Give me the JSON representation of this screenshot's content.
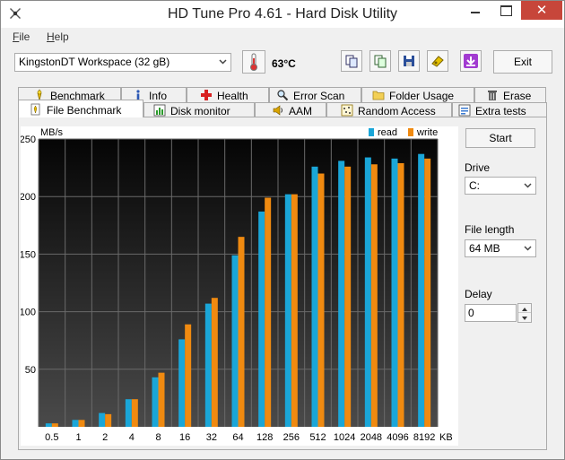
{
  "window": {
    "title": "HD Tune Pro 4.61 - Hard Disk Utility",
    "close_symbol": "✕"
  },
  "menu": {
    "items": [
      {
        "label": "File",
        "underline": "F",
        "rest": "ile"
      },
      {
        "label": "Help",
        "underline": "H",
        "rest": "elp"
      }
    ]
  },
  "toolbar": {
    "drive": "KingstonDT Workspace (32 gB)",
    "temperature": "63°C",
    "exit_label": "Exit",
    "buttons": [
      "copy-info-icon",
      "copy-screenshot-icon",
      "save-icon",
      "options-icon",
      "download-icon"
    ]
  },
  "tabs": {
    "top": [
      {
        "label": "Benchmark",
        "icon": "benchmark-icon"
      },
      {
        "label": "Info",
        "icon": "info-icon"
      },
      {
        "label": "Health",
        "icon": "health-icon"
      },
      {
        "label": "Error Scan",
        "icon": "error-scan-icon"
      },
      {
        "label": "Folder Usage",
        "icon": "folder-icon"
      },
      {
        "label": "Erase",
        "icon": "trash-icon"
      }
    ],
    "bottom": [
      {
        "label": "File Benchmark",
        "icon": "file-benchmark-icon",
        "active": true
      },
      {
        "label": "Disk monitor",
        "icon": "disk-monitor-icon"
      },
      {
        "label": "AAM",
        "icon": "speaker-icon"
      },
      {
        "label": "Random Access",
        "icon": "random-access-icon"
      },
      {
        "label": "Extra tests",
        "icon": "extra-tests-icon"
      }
    ]
  },
  "controls": {
    "start_label": "Start",
    "drive_label": "Drive",
    "drive_value": "C:",
    "file_length_label": "File length",
    "file_length_value": "64 MB",
    "delay_label": "Delay",
    "delay_value": "0"
  },
  "colors": {
    "read": "#1aa6d8",
    "write": "#f08a10",
    "chart_bg_top": "#050505",
    "chart_bg_bottom": "#4a4a4a"
  },
  "chart_data": {
    "type": "bar",
    "ylabel": "MB/s",
    "xunit": "KB",
    "ylim": [
      0,
      250
    ],
    "yticks": [
      50,
      100,
      150,
      200,
      250
    ],
    "categories": [
      "0.5",
      "1",
      "2",
      "4",
      "8",
      "16",
      "32",
      "64",
      "128",
      "256",
      "512",
      "1024",
      "2048",
      "4096",
      "8192"
    ],
    "series": [
      {
        "name": "read",
        "values": [
          3,
          6,
          12,
          24,
          43,
          76,
          107,
          149,
          187,
          202,
          226,
          231,
          234,
          233,
          237
        ]
      },
      {
        "name": "write",
        "values": [
          3,
          6,
          11,
          24,
          47,
          89,
          112,
          165,
          199,
          202,
          220,
          226,
          228,
          229,
          233
        ]
      }
    ],
    "legend_position": "top-right",
    "grid": true
  }
}
